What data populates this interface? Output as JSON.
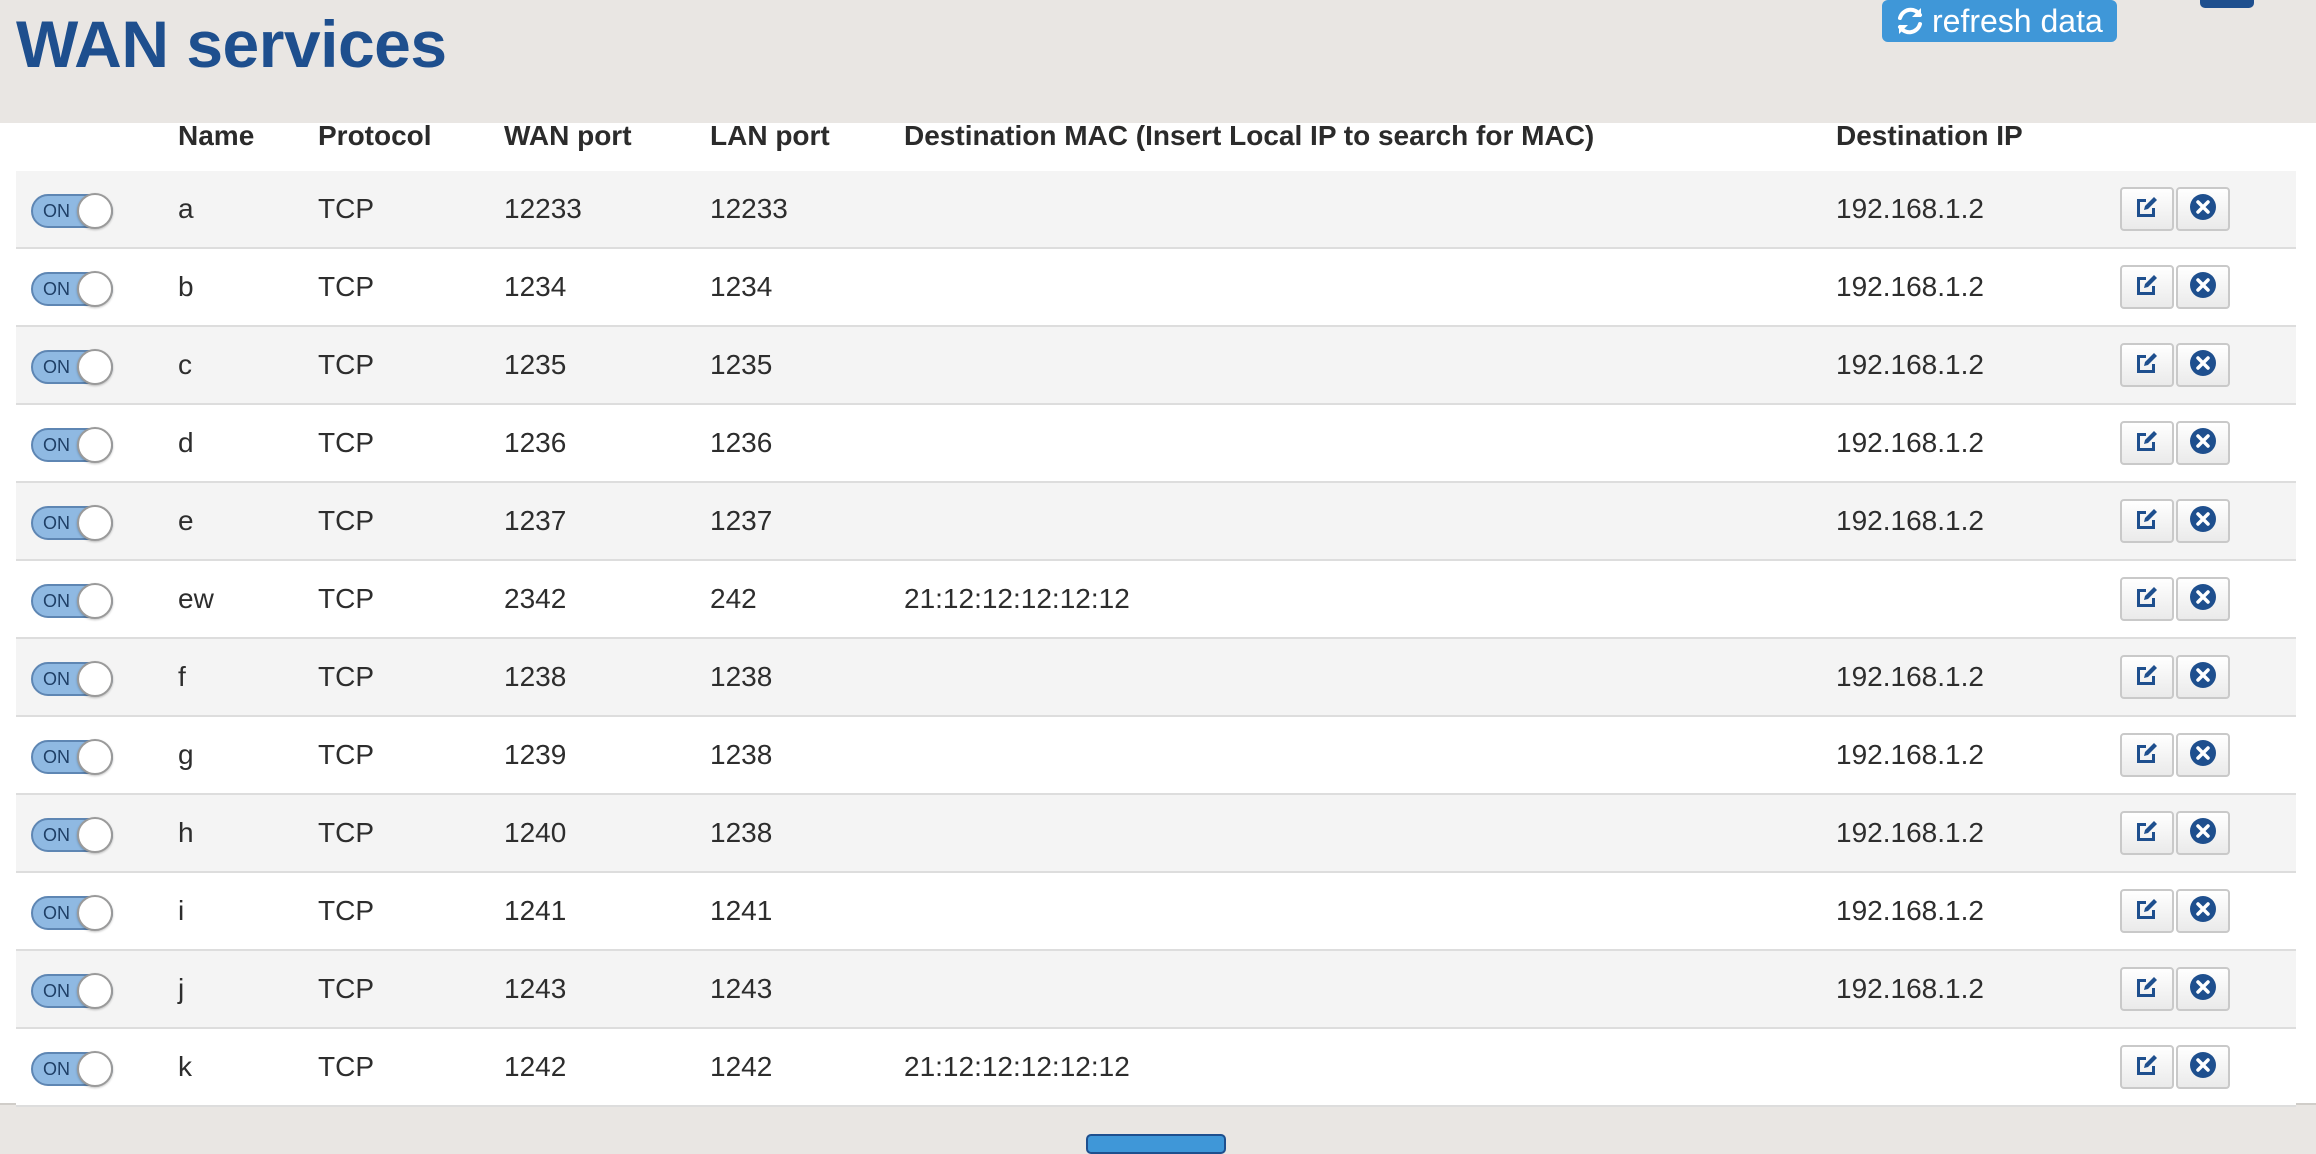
{
  "header": {
    "title": "WAN services",
    "refresh_label": "refresh data",
    "refresh_icon": "refresh-icon"
  },
  "table": {
    "columns": {
      "name": "Name",
      "protocol": "Protocol",
      "wan_port": "WAN port",
      "lan_port": "LAN port",
      "dest_mac": "Destination MAC (Insert Local IP to search for MAC)",
      "dest_ip": "Destination IP"
    },
    "toggle_on_label": "ON",
    "rows": [
      {
        "enabled": true,
        "name": "a",
        "protocol": "TCP",
        "wan_port": "12233",
        "lan_port": "12233",
        "dest_mac": "",
        "dest_ip": "192.168.1.2"
      },
      {
        "enabled": true,
        "name": "b",
        "protocol": "TCP",
        "wan_port": "1234",
        "lan_port": "1234",
        "dest_mac": "",
        "dest_ip": "192.168.1.2"
      },
      {
        "enabled": true,
        "name": "c",
        "protocol": "TCP",
        "wan_port": "1235",
        "lan_port": "1235",
        "dest_mac": "",
        "dest_ip": "192.168.1.2"
      },
      {
        "enabled": true,
        "name": "d",
        "protocol": "TCP",
        "wan_port": "1236",
        "lan_port": "1236",
        "dest_mac": "",
        "dest_ip": "192.168.1.2"
      },
      {
        "enabled": true,
        "name": "e",
        "protocol": "TCP",
        "wan_port": "1237",
        "lan_port": "1237",
        "dest_mac": "",
        "dest_ip": "192.168.1.2"
      },
      {
        "enabled": true,
        "name": "ew",
        "protocol": "TCP",
        "wan_port": "2342",
        "lan_port": "242",
        "dest_mac": "21:12:12:12:12:12",
        "dest_ip": ""
      },
      {
        "enabled": true,
        "name": "f",
        "protocol": "TCP",
        "wan_port": "1238",
        "lan_port": "1238",
        "dest_mac": "",
        "dest_ip": "192.168.1.2"
      },
      {
        "enabled": true,
        "name": "g",
        "protocol": "TCP",
        "wan_port": "1239",
        "lan_port": "1238",
        "dest_mac": "",
        "dest_ip": "192.168.1.2"
      },
      {
        "enabled": true,
        "name": "h",
        "protocol": "TCP",
        "wan_port": "1240",
        "lan_port": "1238",
        "dest_mac": "",
        "dest_ip": "192.168.1.2"
      },
      {
        "enabled": true,
        "name": "i",
        "protocol": "TCP",
        "wan_port": "1241",
        "lan_port": "1241",
        "dest_mac": "",
        "dest_ip": "192.168.1.2"
      },
      {
        "enabled": true,
        "name": "j",
        "protocol": "TCP",
        "wan_port": "1243",
        "lan_port": "1243",
        "dest_mac": "",
        "dest_ip": "192.168.1.2"
      },
      {
        "enabled": true,
        "name": "k",
        "protocol": "TCP",
        "wan_port": "1242",
        "lan_port": "1242",
        "dest_mac": "21:12:12:12:12:12",
        "dest_ip": ""
      }
    ],
    "row_actions": {
      "edit_icon": "edit-icon",
      "delete_icon": "delete-icon"
    }
  },
  "colors": {
    "title": "#1e4f8e",
    "accent": "#3f97d8",
    "toggle_on": "#8fb9e2",
    "action_icon": "#1e4f8e"
  }
}
